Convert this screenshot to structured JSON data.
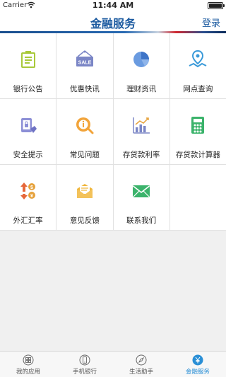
{
  "status_bar": {
    "carrier": "Carrier",
    "time": "11:44 AM"
  },
  "nav": {
    "title": "金融服务",
    "login_label": "登录"
  },
  "grid": {
    "items": [
      {
        "label": "银行公告",
        "icon": "notice-board-icon"
      },
      {
        "label": "优惠快讯",
        "icon": "sale-tag-icon"
      },
      {
        "label": "理财资讯",
        "icon": "pie-chart-icon"
      },
      {
        "label": "网点查询",
        "icon": "map-pin-icon"
      },
      {
        "label": "安全提示",
        "icon": "security-tablet-icon"
      },
      {
        "label": "常见问题",
        "icon": "info-question-icon"
      },
      {
        "label": "存贷款利率",
        "icon": "bar-chart-icon"
      },
      {
        "label": "存贷款计算器",
        "icon": "calculator-icon"
      },
      {
        "label": "外汇汇率",
        "icon": "currency-exchange-icon"
      },
      {
        "label": "意见反馈",
        "icon": "feedback-envelope-icon"
      },
      {
        "label": "联系我们",
        "icon": "contact-mail-icon"
      }
    ]
  },
  "tabs": [
    {
      "label": "我的应用",
      "icon": "apps-grid-icon",
      "active": false
    },
    {
      "label": "手机银行",
      "icon": "mobile-bank-icon",
      "active": false
    },
    {
      "label": "生活助手",
      "icon": "compass-icon",
      "active": false
    },
    {
      "label": "金融服务",
      "icon": "yuan-coin-icon",
      "active": true
    }
  ],
  "colors": {
    "brand": "#1b5aa0",
    "active_tab": "#2a8fd6"
  }
}
